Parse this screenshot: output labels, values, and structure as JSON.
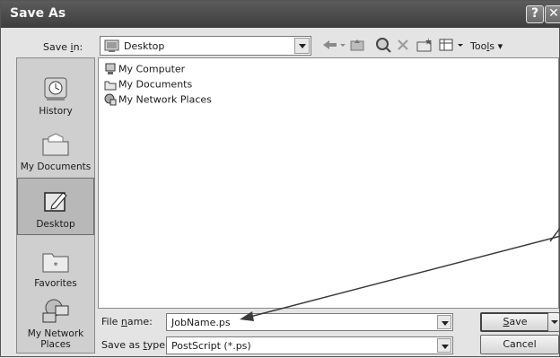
{
  "window": {
    "title": "Save As",
    "help_glyph": "?",
    "close_glyph": "✕"
  },
  "save_in": {
    "label_pre": "Save ",
    "label_u": "i",
    "label_post": "n:",
    "value": "Desktop",
    "icon": "desktop-folder-icon"
  },
  "toolbar": {
    "icons": [
      "back-arrow-icon",
      "up-folder-icon",
      "search-web-icon",
      "delete-icon",
      "new-folder-icon",
      "views-icon"
    ],
    "tools_pre": "Too",
    "tools_u": "l",
    "tools_post": "s",
    "tools_arrow": "▾"
  },
  "places": [
    {
      "label": "History",
      "icon": "history-icon",
      "active": false
    },
    {
      "label": "My Documents",
      "icon": "my-documents-icon",
      "active": false
    },
    {
      "label": "Desktop",
      "icon": "desktop-icon",
      "active": true
    },
    {
      "label": "Favorites",
      "icon": "favorites-icon",
      "active": false
    },
    {
      "label": "My Network\nPlaces",
      "icon": "network-places-icon",
      "active": false
    }
  ],
  "files": [
    {
      "label": "My Computer",
      "icon": "computer-icon"
    },
    {
      "label": "My Documents",
      "icon": "documents-folder-icon"
    },
    {
      "label": "My Network Places",
      "icon": "network-icon"
    }
  ],
  "file_name": {
    "label_pre": "File ",
    "label_u": "n",
    "label_post": "ame:",
    "value": "JobName.ps"
  },
  "save_as_type": {
    "label_pre": "Save as ",
    "label_u": "t",
    "label_post": "ype:",
    "value": "PostScript (*.ps)"
  },
  "buttons": {
    "save_u": "S",
    "save_rest": "ave",
    "cancel": "Cancel"
  }
}
